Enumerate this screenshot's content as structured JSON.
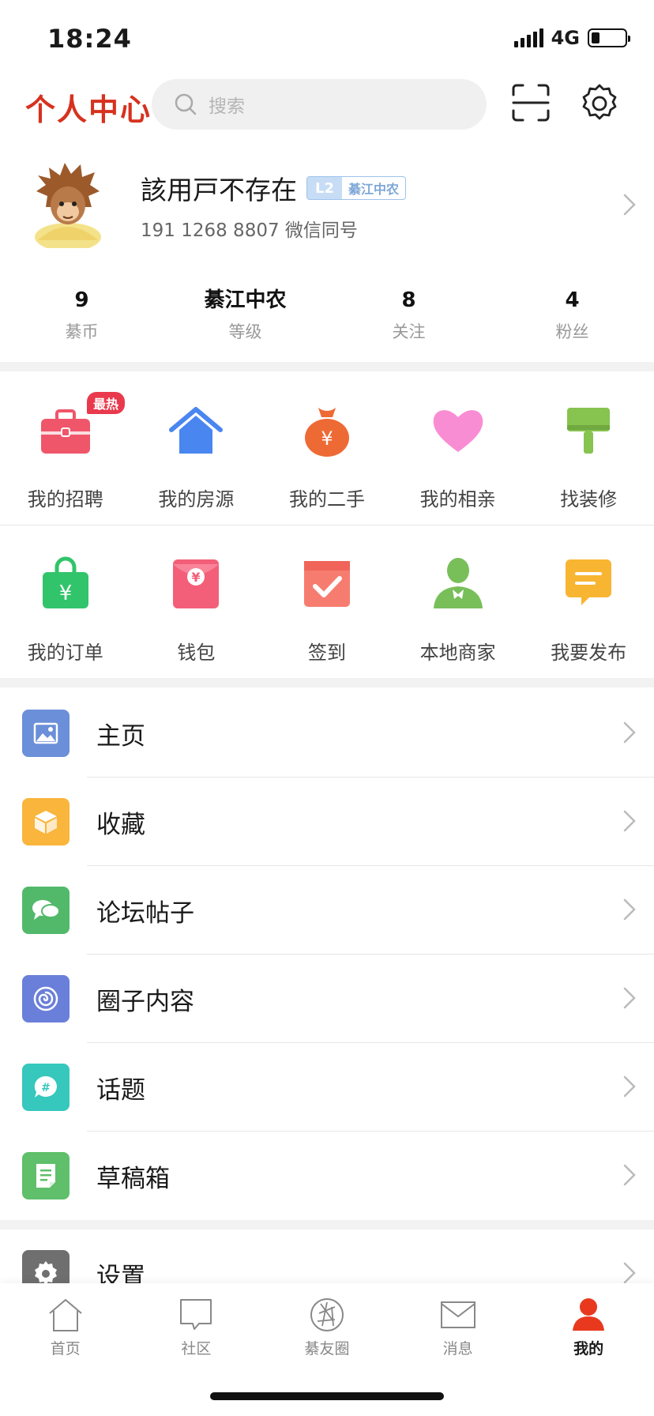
{
  "status": {
    "time": "18:24",
    "network": "4G",
    "battery_level": 0.25
  },
  "header": {
    "title": "个人中心",
    "search_placeholder": "搜索",
    "scan_icon": "scan-icon",
    "settings_icon": "gear-icon"
  },
  "profile": {
    "name": "該用戸不存在",
    "level": "L2",
    "level_org": "綦江中农",
    "phone_line": "191 1268 8807 微信同号"
  },
  "stats": [
    {
      "value": "9",
      "label": "綦币"
    },
    {
      "value": "綦江中农",
      "label": "等级"
    },
    {
      "value": "8",
      "label": "关注"
    },
    {
      "value": "4",
      "label": "粉丝"
    }
  ],
  "grid_row1": [
    {
      "label": "我的招聘",
      "icon": "briefcase-icon",
      "badge": "最热"
    },
    {
      "label": "我的房源",
      "icon": "house-icon"
    },
    {
      "label": "我的二手",
      "icon": "money-bag-icon"
    },
    {
      "label": "我的相亲",
      "icon": "heart-icon"
    },
    {
      "label": "找装修",
      "icon": "paint-roller-icon"
    }
  ],
  "grid_row2": [
    {
      "label": "我的订单",
      "icon": "shopping-bag-icon"
    },
    {
      "label": "钱包",
      "icon": "red-envelope-icon"
    },
    {
      "label": "签到",
      "icon": "checkin-icon"
    },
    {
      "label": "本地商家",
      "icon": "merchant-icon"
    },
    {
      "label": "我要发布",
      "icon": "message-icon"
    }
  ],
  "menu": [
    {
      "label": "主页",
      "icon": "image-icon",
      "color": "#6b8fd8"
    },
    {
      "label": "收藏",
      "icon": "box-icon",
      "color": "#f9b53c"
    },
    {
      "label": "论坛帖子",
      "icon": "chat-bubbles-icon",
      "color": "#52b96b"
    },
    {
      "label": "圈子内容",
      "icon": "circle-swirl-icon",
      "color": "#6a7fd9"
    },
    {
      "label": "话题",
      "icon": "hashtag-icon",
      "color": "#36c7bd"
    },
    {
      "label": "草稿箱",
      "icon": "draft-icon",
      "color": "#5fbf6a"
    }
  ],
  "settings": {
    "label": "设置",
    "icon": "settings-gear-icon",
    "color": "#6f6f6f"
  },
  "tabs": [
    {
      "label": "首页",
      "icon": "home-icon"
    },
    {
      "label": "社区",
      "icon": "chat-box-icon"
    },
    {
      "label": "綦友圈",
      "icon": "aperture-icon"
    },
    {
      "label": "消息",
      "icon": "envelope-icon"
    },
    {
      "label": "我的",
      "icon": "user-icon",
      "active": true
    }
  ],
  "colors": {
    "accent": "#d6321f",
    "active_tab": "#e8391e",
    "hot_badge": "#e93a4d"
  }
}
